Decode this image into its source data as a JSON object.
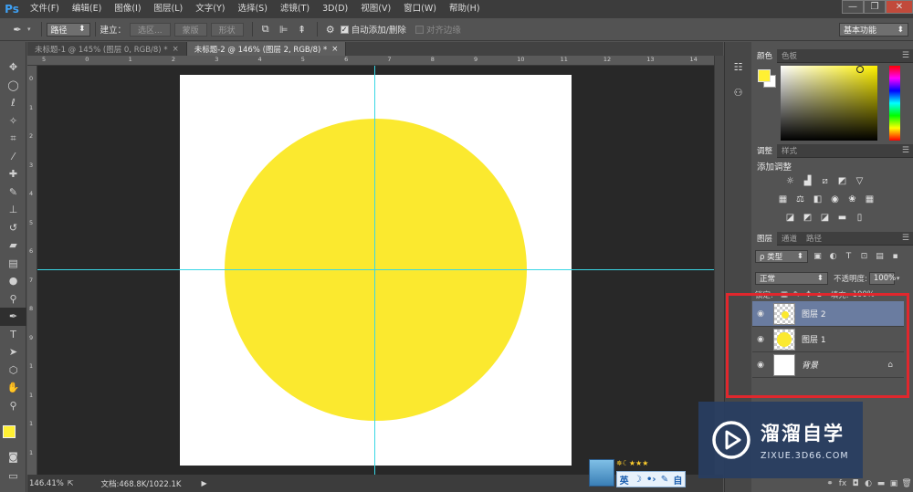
{
  "app": {
    "logo": "Ps"
  },
  "menu": [
    "文件(F)",
    "编辑(E)",
    "图像(I)",
    "图层(L)",
    "文字(Y)",
    "选择(S)",
    "滤镜(T)",
    "3D(D)",
    "视图(V)",
    "窗口(W)",
    "帮助(H)"
  ],
  "window_controls": {
    "minimize": "—",
    "restore": "❐",
    "close": "✕"
  },
  "options_bar": {
    "tool_mode": "路径",
    "build_label": "建立：",
    "btn_selection": "选区...",
    "btn_mask": "蒙版",
    "btn_shape": "形状",
    "auto_add_delete": "自动添加/删除",
    "align_edges": "对齐边缘",
    "workspace": "基本功能"
  },
  "tabs": [
    {
      "label": "未标题-1 @ 145% (图层 0, RGB/8) *",
      "close": "×"
    },
    {
      "label": "未标题-2 @ 146% (图层 2, RGB/8) *",
      "close": "×"
    }
  ],
  "rulers": {
    "h": [
      "5",
      "0",
      "1",
      "2",
      "3",
      "4",
      "5",
      "6",
      "7",
      "8",
      "9",
      "10",
      "11",
      "12",
      "13",
      "14"
    ],
    "v": [
      "0",
      "1",
      "2",
      "3",
      "4",
      "5",
      "6",
      "7",
      "8",
      "9",
      "1",
      "1",
      "1",
      "1"
    ]
  },
  "status": {
    "zoom": "146.41%",
    "doc_info": "文档:468.8K/1022.1K"
  },
  "ime": {
    "stars": "✵☾★★★",
    "items": [
      "英",
      "☽",
      "•›",
      "✎",
      "自"
    ]
  },
  "panels": {
    "color_tabs": [
      "颜色",
      "色板"
    ],
    "adjust_tabs": [
      "调整",
      "样式"
    ],
    "adjust_title": "添加调整",
    "layers_tabs": [
      "图层",
      "通道",
      "路径"
    ],
    "filter_kind": "ρ 类型",
    "blend_mode": "正常",
    "opacity_label": "不透明度:",
    "opacity_value": "100%",
    "lock_label": "锁定:",
    "fill_label": "填充:",
    "fill_value": "100%",
    "layers": [
      {
        "name": "图层 2",
        "selected": true,
        "thumb": "checker-dot"
      },
      {
        "name": "图层 1",
        "selected": false,
        "thumb": "checker-circle"
      },
      {
        "name": "背景",
        "selected": false,
        "thumb": "white",
        "locked": true
      }
    ]
  },
  "watermark": {
    "brand": "溜溜自学",
    "url": "ZIXUE.3D66.COM"
  },
  "colors": {
    "foreground": "#fff033",
    "background": "#ffffff",
    "circle": "#fbe92f",
    "guide": "#39d7e5",
    "highlight": "#e0272d"
  }
}
